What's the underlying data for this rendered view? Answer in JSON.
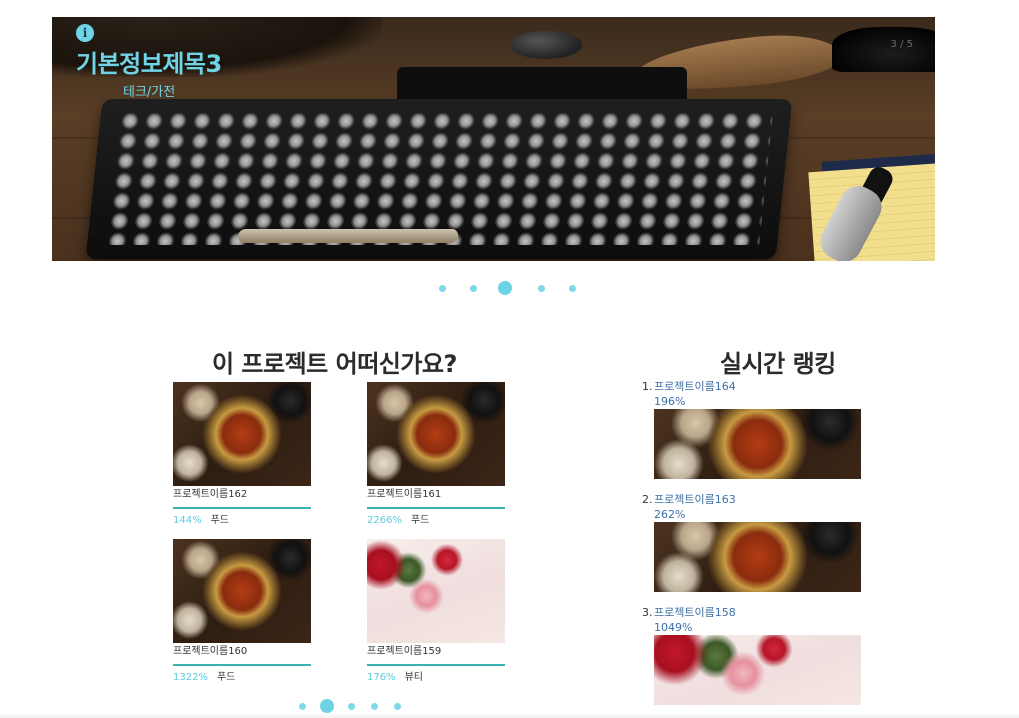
{
  "hero": {
    "title": "기본정보제목3",
    "category": "테크/가전",
    "counter": "3 / 5",
    "info_icon": "info-icon",
    "slides": 5,
    "active_slide": 3
  },
  "sections": {
    "recommend_title": "이 프로젝트 어떠신가요?",
    "ranking_title": "실시간 랭킹"
  },
  "projects": [
    {
      "name": "프로젝트이름162",
      "percent": "144%",
      "category": "푸드",
      "image": "food"
    },
    {
      "name": "프로젝트이름161",
      "percent": "2266%",
      "category": "푸드",
      "image": "food"
    },
    {
      "name": "프로젝트이름160",
      "percent": "1322%",
      "category": "푸드",
      "image": "food"
    },
    {
      "name": "프로젝트이름159",
      "percent": "176%",
      "category": "뷰티",
      "image": "beauty"
    }
  ],
  "grid_pagination": {
    "pages": 5,
    "active_page": 2
  },
  "ranking": [
    {
      "rank": "1.",
      "name": "프로젝트이름164",
      "percent": "196%",
      "image": "food"
    },
    {
      "rank": "2.",
      "name": "프로젝트이름163",
      "percent": "262%",
      "image": "food"
    },
    {
      "rank": "3.",
      "name": "프로젝트이름158",
      "percent": "1049%",
      "image": "beauty"
    }
  ],
  "colors": {
    "accent": "#6fd4e6",
    "progress_bar": "#38b3b0",
    "ranking_link": "#3d6fa6"
  }
}
